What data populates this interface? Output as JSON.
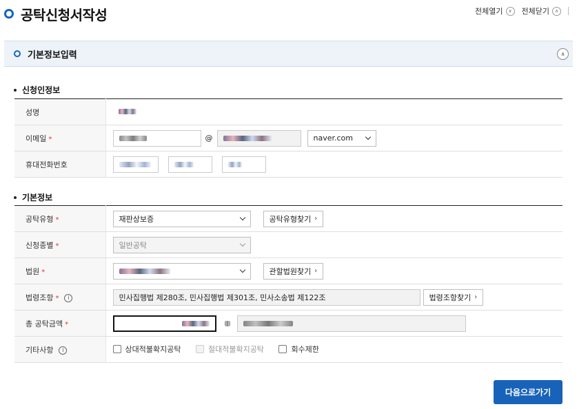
{
  "page": {
    "title": "공탁신청서작성"
  },
  "toolbar": {
    "expand_all": "전체열기",
    "collapse_all": "전체닫기"
  },
  "section": {
    "title": "기본정보입력"
  },
  "applicant": {
    "group_title": "신청인정보",
    "name_label": "성명",
    "email_label": "이메일",
    "email_at": "@",
    "email_domain": "naver.com",
    "phone_label": "휴대전화번호"
  },
  "basic": {
    "group_title": "기본정보",
    "type_label": "공탁유형",
    "type_value": "재판상보증",
    "type_button": "공탁유형찾기",
    "kind_label": "신청종별",
    "kind_value": "일반공탁",
    "court_label": "법원",
    "court_button": "관할법원찾기",
    "law_label": "법령조항",
    "law_value": "민사집행법 제280조, 민사집행법 제301조, 민사소송법 제122조",
    "law_button": "법령조항찾기",
    "amount_label": "총 공탁금액",
    "other_label": "기타사항",
    "check_relative": "상대적불확지공탁",
    "check_absolute": "절대적불확지공탁",
    "check_recovery": "회수제한"
  },
  "actions": {
    "next": "다음으로가기"
  },
  "colors": {
    "accent": "#1862b9",
    "section_bg": "#eef3fa",
    "required": "#d33333"
  },
  "icons": {
    "title": "ring-icon",
    "expand": "chevron-down-icon",
    "collapse": "chevron-up-icon",
    "info": "info-icon",
    "select": "chevron-down-icon",
    "button": "chevron-right-icon"
  }
}
